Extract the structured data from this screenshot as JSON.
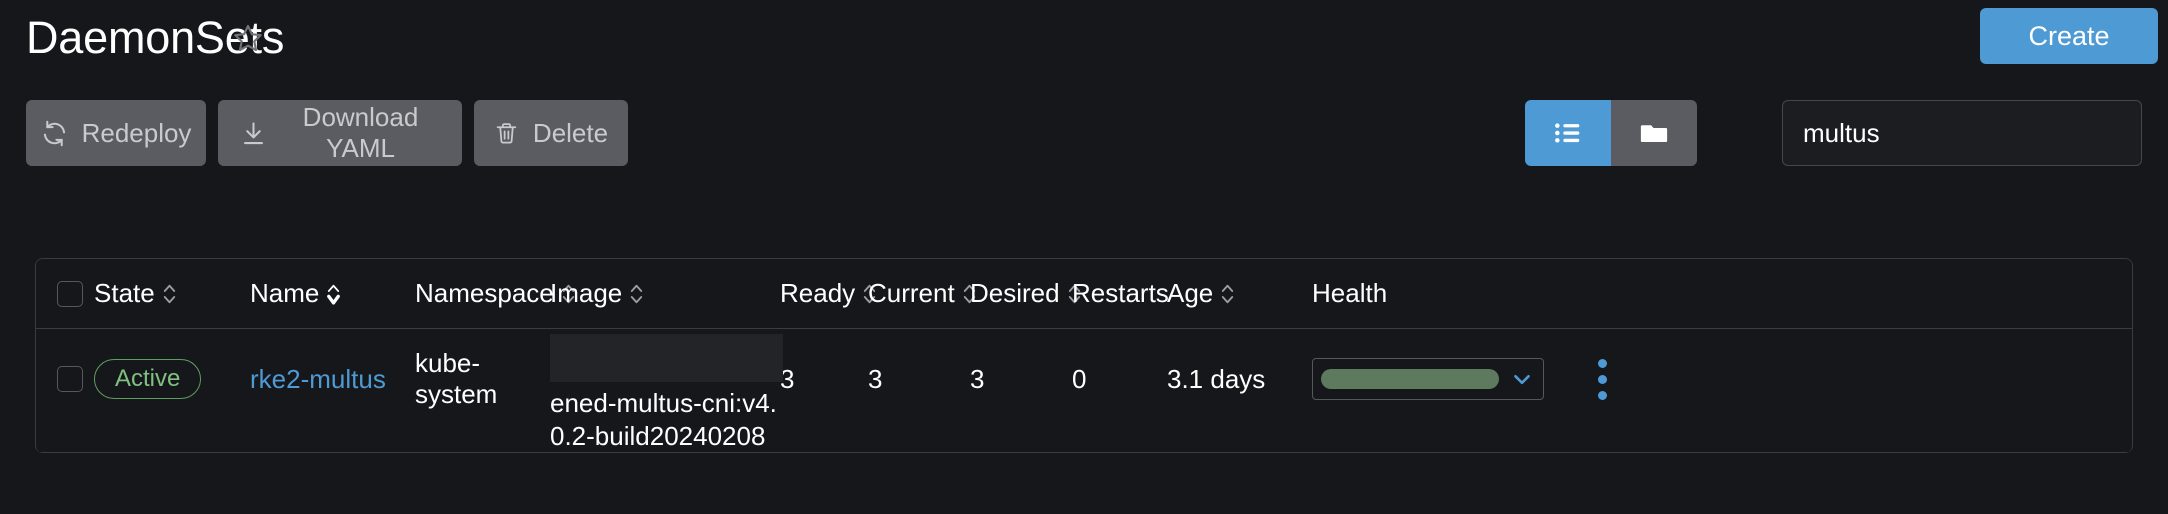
{
  "header": {
    "title": "DaemonSets",
    "favorite_icon": "star-outline-icon",
    "create_label": "Create"
  },
  "toolbar": {
    "redeploy_label": "Redeploy",
    "redeploy_icon": "refresh-icon",
    "download_label": "Download YAML",
    "download_icon": "download-icon",
    "delete_label": "Delete",
    "delete_icon": "trash-icon",
    "view_list_icon": "list-view-icon",
    "view_folder_icon": "folder-view-icon",
    "active_view": "list",
    "search_value": "multus",
    "search_placeholder": "Filter"
  },
  "colors": {
    "accent": "#4e9ad4",
    "button_bg": "#5a5c61",
    "page_bg": "#16171b",
    "border": "#3a3c41",
    "state_green": "#80c080",
    "health_green": "#5d7a5f"
  },
  "table": {
    "columns": [
      {
        "label": "State",
        "sortable": true,
        "sorted": false
      },
      {
        "label": "Name",
        "sortable": true,
        "sorted": true
      },
      {
        "label": "Namespace",
        "sortable": true,
        "sorted": false
      },
      {
        "label": "Image",
        "sortable": true,
        "sorted": false
      },
      {
        "label": "Ready",
        "sortable": true,
        "sorted": false
      },
      {
        "label": "Current",
        "sortable": true,
        "sorted": false
      },
      {
        "label": "Desired",
        "sortable": true,
        "sorted": false
      },
      {
        "label": "Restarts",
        "sortable": false,
        "sorted": false
      },
      {
        "label": "Age",
        "sortable": true,
        "sorted": false
      },
      {
        "label": "Health",
        "sortable": false,
        "sorted": false
      }
    ],
    "rows": [
      {
        "state": "Active",
        "name": "rke2-multus",
        "namespace": "kube-system",
        "image_redacted": true,
        "image": "ened-multus-cni:v4.0.2-build20240208",
        "ready": "3",
        "current": "3",
        "desired": "3",
        "restarts": "0",
        "age": "3.1 days",
        "health_value": "",
        "menu_icon": "kebab-menu-icon"
      }
    ]
  }
}
